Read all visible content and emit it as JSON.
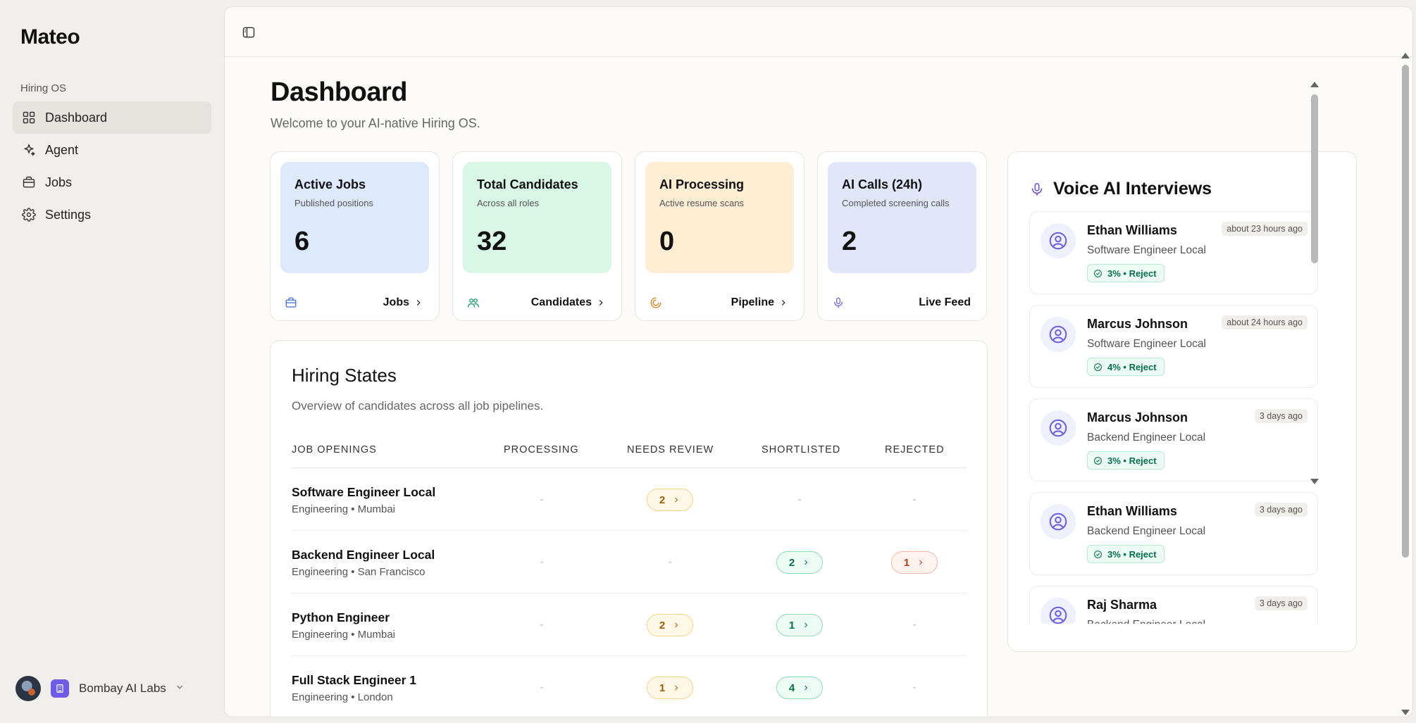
{
  "sidebar": {
    "brand": "Mateo",
    "section_label": "Hiring OS",
    "items": [
      {
        "label": "Dashboard",
        "icon": "dashboard-grid-icon",
        "active": true
      },
      {
        "label": "Agent",
        "icon": "sparkle-icon",
        "active": false
      },
      {
        "label": "Jobs",
        "icon": "briefcase-icon",
        "active": false
      },
      {
        "label": "Settings",
        "icon": "gear-icon",
        "active": false
      }
    ],
    "org_name": "Bombay AI Labs"
  },
  "header": {
    "title": "Dashboard",
    "subtitle": "Welcome to your AI-native Hiring OS."
  },
  "stats": [
    {
      "title": "Active Jobs",
      "desc": "Published positions",
      "value": "6",
      "link": "Jobs",
      "color": "#dde9fd",
      "icon": "briefcase-icon",
      "icon_color": "#3b6fd8"
    },
    {
      "title": "Total Candidates",
      "desc": "Across all roles",
      "value": "32",
      "link": "Candidates",
      "color": "#d9f7e6",
      "icon": "users-icon",
      "icon_color": "#119462"
    },
    {
      "title": "AI Processing",
      "desc": "Active resume scans",
      "value": "0",
      "link": "Pipeline",
      "color": "#ffedd4",
      "icon": "loader-icon",
      "icon_color": "#e07a12"
    },
    {
      "title": "AI Calls (24h)",
      "desc": "Completed screening calls",
      "value": "2",
      "link": "Live Feed",
      "color": "#e2e6fb",
      "icon": "mic-icon",
      "icon_color": "#6d5ce8"
    }
  ],
  "hiring": {
    "title": "Hiring States",
    "subtitle": "Overview of candidates across all job pipelines.",
    "columns": [
      "JOB OPENINGS",
      "PROCESSING",
      "NEEDS REVIEW",
      "SHORTLISTED",
      "REJECTED"
    ],
    "rows": [
      {
        "title": "Software Engineer Local",
        "meta": "Engineering • Mumbai",
        "processing": "-",
        "review": "2",
        "shortlisted": "-",
        "rejected": "-"
      },
      {
        "title": "Backend Engineer Local",
        "meta": "Engineering • San Francisco",
        "processing": "-",
        "review": "-",
        "shortlisted": "2",
        "rejected": "1"
      },
      {
        "title": "Python Engineer",
        "meta": "Engineering • Mumbai",
        "processing": "-",
        "review": "2",
        "shortlisted": "1",
        "rejected": "-"
      },
      {
        "title": "Full Stack Engineer 1",
        "meta": "Engineering • London",
        "processing": "-",
        "review": "1",
        "shortlisted": "4",
        "rejected": "-"
      }
    ]
  },
  "voice": {
    "title": "Voice AI Interviews",
    "items": [
      {
        "name": "Ethan Williams",
        "role": "Software Engineer Local",
        "time": "about 23 hours ago",
        "score": "3% • Reject"
      },
      {
        "name": "Marcus Johnson",
        "role": "Software Engineer Local",
        "time": "about 24 hours ago",
        "score": "4% • Reject"
      },
      {
        "name": "Marcus Johnson",
        "role": "Backend Engineer Local",
        "time": "3 days ago",
        "score": "3% • Reject"
      },
      {
        "name": "Ethan Williams",
        "role": "Backend Engineer Local",
        "time": "3 days ago",
        "score": "3% • Reject"
      },
      {
        "name": "Raj Sharma",
        "role": "Backend Engineer Local",
        "time": "3 days ago",
        "score": ""
      }
    ]
  }
}
